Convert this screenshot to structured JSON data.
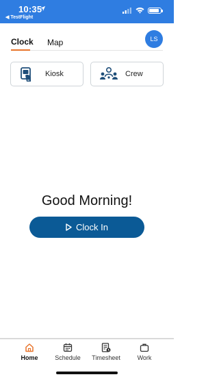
{
  "status_bar": {
    "time": "10:35",
    "back_label": "◀ TestFlight",
    "background": "#2f7de1",
    "battery_level": 0.9,
    "icons": [
      "location-arrow-icon",
      "cellular-signal-icon",
      "wifi-icon",
      "battery-icon"
    ]
  },
  "top_tabs": {
    "items": [
      {
        "label": "Clock",
        "active": true
      },
      {
        "label": "Map",
        "active": false
      }
    ],
    "active_color": "#e8742b"
  },
  "avatar": {
    "initials": "LS",
    "color": "#2f7de1"
  },
  "cards": [
    {
      "label": "Kiosk",
      "icon": "kiosk-icon"
    },
    {
      "label": "Crew",
      "icon": "crew-icon"
    }
  ],
  "greeting": "Good Morning!",
  "clock_in": {
    "label": "Clock In",
    "icon": "play-outline-icon",
    "color": "#0b5a96"
  },
  "bottom_nav": {
    "items": [
      {
        "label": "Home",
        "icon": "home-icon",
        "active": true
      },
      {
        "label": "Schedule",
        "icon": "calendar-icon",
        "active": false
      },
      {
        "label": "Timesheet",
        "icon": "timesheet-icon",
        "active": false
      },
      {
        "label": "Work",
        "icon": "briefcase-icon",
        "active": false
      }
    ],
    "active_color": "#e8742b"
  }
}
